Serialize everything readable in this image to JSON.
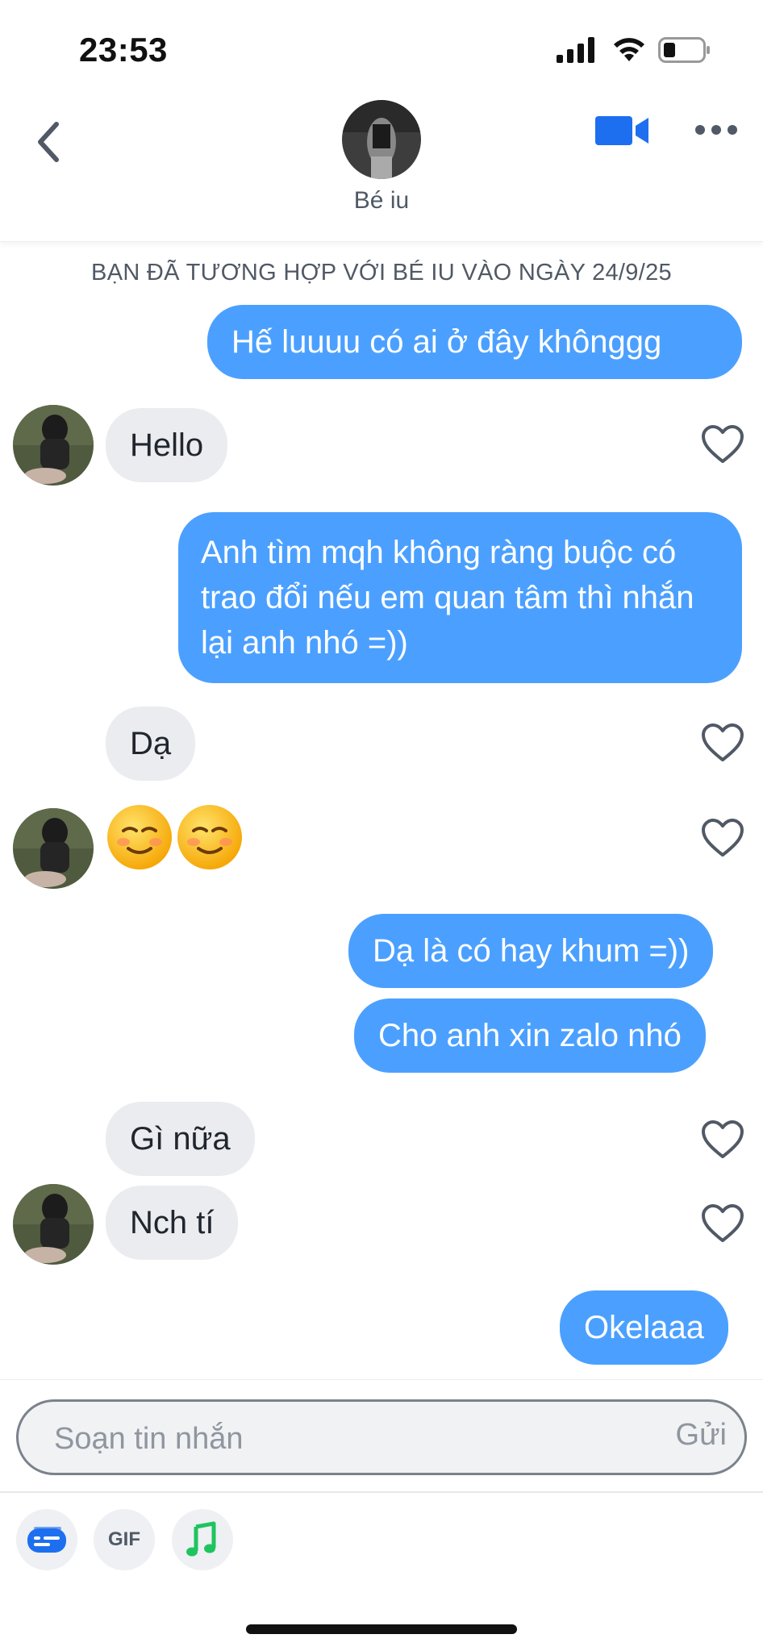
{
  "status_bar": {
    "time": "23:53"
  },
  "header": {
    "contact_name": "Bé iu"
  },
  "conversation": {
    "match_banner": "BẠN ĐÃ TƯƠNG HỢP VỚI BÉ IU VÀO NGÀY 24/9/25",
    "messages": [
      {
        "sender": "me",
        "text": "Hế luuuu có ai ở đây khônggg"
      },
      {
        "sender": "them",
        "text": "Hello"
      },
      {
        "sender": "me",
        "text": "Anh tìm mqh không ràng buộc có trao đổi nếu em quan tâm thì nhắn lại anh nhó =))"
      },
      {
        "sender": "them",
        "text": "Dạ"
      },
      {
        "sender": "them",
        "text": "emoji",
        "emoji": "smiling-face-with-blush x2"
      },
      {
        "sender": "me",
        "text": "Dạ là có hay khum =))"
      },
      {
        "sender": "me",
        "text": "Cho anh xin zalo nhó"
      },
      {
        "sender": "them",
        "text": "Gì nữa"
      },
      {
        "sender": "them",
        "text": "Nch tí"
      },
      {
        "sender": "me",
        "text": "Okelaaa"
      }
    ]
  },
  "composer": {
    "placeholder": "Soạn tin nhắn",
    "send_label": "Gửi",
    "gif_label": "GIF"
  },
  "colors": {
    "outgoing_bubble": "#4ba0ff",
    "incoming_bubble": "#ebecf0",
    "video_icon": "#1e6ff0",
    "music_icon": "#1fc45e"
  }
}
